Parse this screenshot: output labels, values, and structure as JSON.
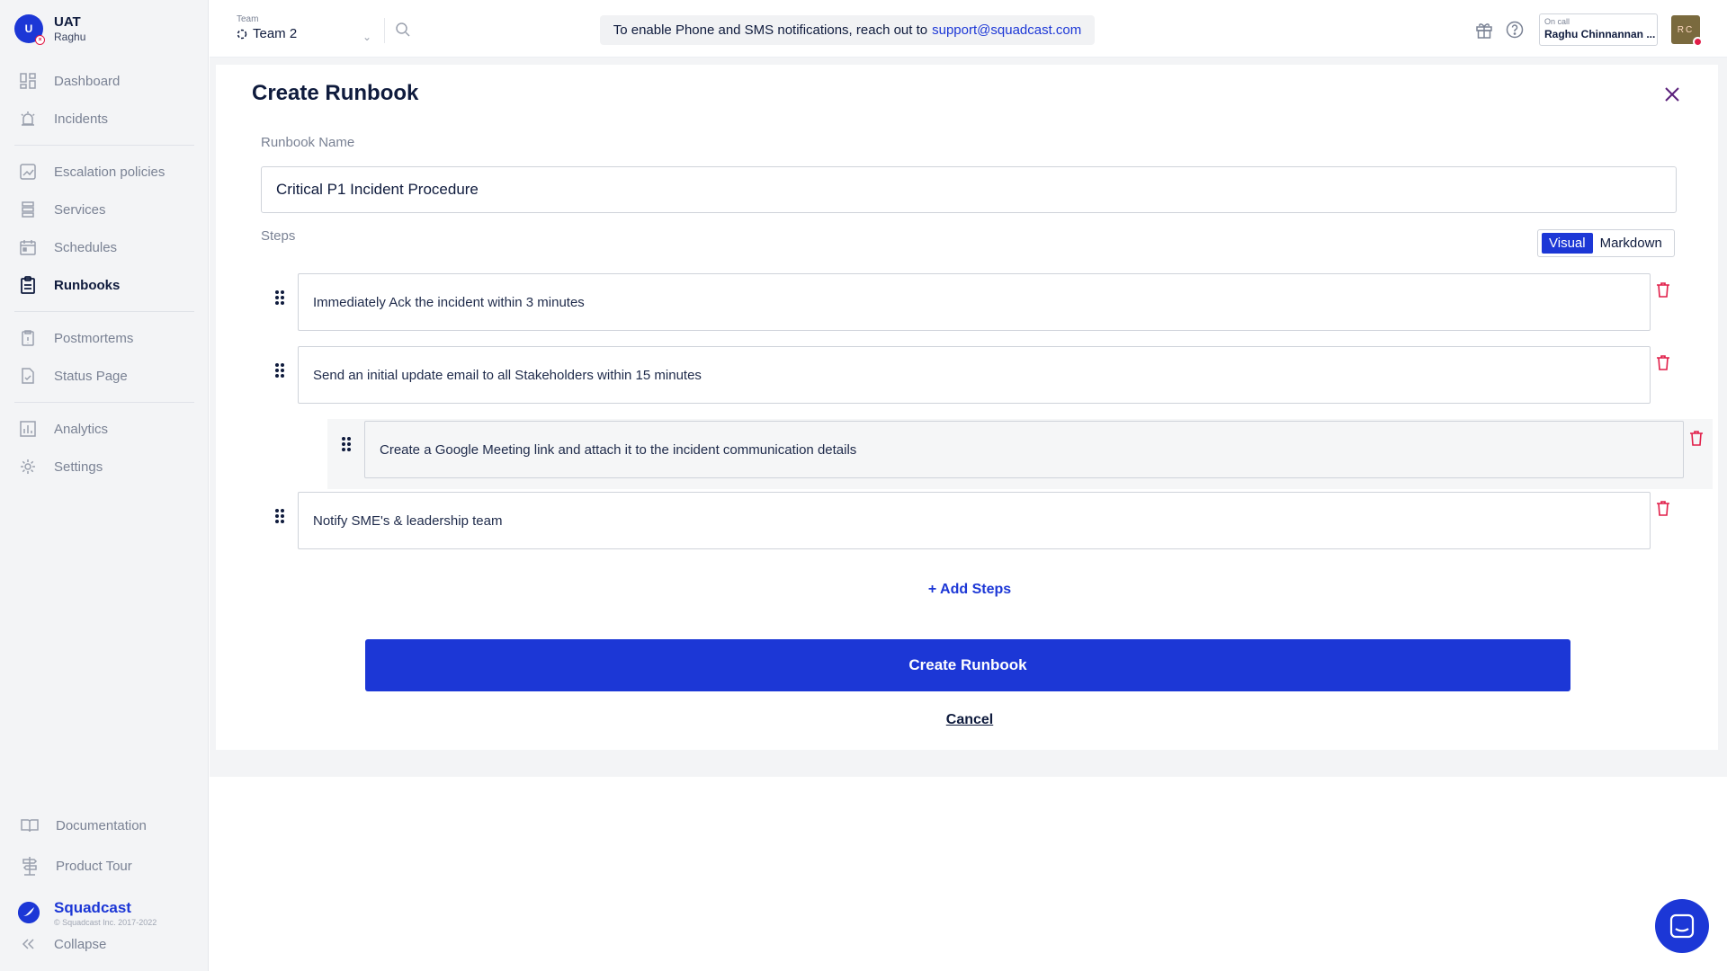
{
  "org": {
    "initial": "U",
    "name": "UAT",
    "user": "Raghu"
  },
  "sidebar": {
    "items": [
      {
        "label": "Dashboard",
        "icon": "dashboard-icon"
      },
      {
        "label": "Incidents",
        "icon": "incidents-icon"
      },
      {
        "label": "Escalation policies",
        "icon": "escalation-icon"
      },
      {
        "label": "Services",
        "icon": "services-icon"
      },
      {
        "label": "Schedules",
        "icon": "calendar-icon"
      },
      {
        "label": "Runbooks",
        "icon": "clipboard-icon"
      },
      {
        "label": "Postmortems",
        "icon": "postmortem-icon"
      },
      {
        "label": "Status Page",
        "icon": "status-page-icon"
      },
      {
        "label": "Analytics",
        "icon": "analytics-icon"
      },
      {
        "label": "Settings",
        "icon": "gear-icon"
      }
    ],
    "bottom": [
      {
        "label": "Documentation",
        "icon": "book-icon"
      },
      {
        "label": "Product Tour",
        "icon": "signpost-icon"
      }
    ],
    "brand_name": "Squadcast",
    "brand_copy": "© Squadcast Inc. 2017-2022",
    "collapse_label": "Collapse"
  },
  "header": {
    "team_label": "Team",
    "team_value": "Team 2",
    "notice_text": "To enable Phone and SMS notifications, reach out to",
    "notice_link": "support@squadcast.com",
    "oncall_label": "On call",
    "oncall_name": "Raghu Chinnannan ...",
    "user_initials": "RC"
  },
  "form": {
    "title": "Create Runbook",
    "name_label": "Runbook Name",
    "name_value": "Critical P1 Incident Procedure",
    "steps_label": "Steps",
    "toggle": {
      "visual": "Visual",
      "markdown": "Markdown"
    },
    "steps": [
      "Immediately Ack the incident within 3 minutes",
      "Send an initial update email to all Stakeholders within 15 minutes",
      "Create a Google Meeting link and attach it to the incident communication details",
      "Notify SME's & leadership team"
    ],
    "add_steps": "+ Add Steps",
    "create_button": "Create Runbook",
    "cancel": "Cancel"
  },
  "colors": {
    "accent": "#1c37d6",
    "danger": "#e11d48",
    "sidebar_bg": "#f3f4f6"
  }
}
